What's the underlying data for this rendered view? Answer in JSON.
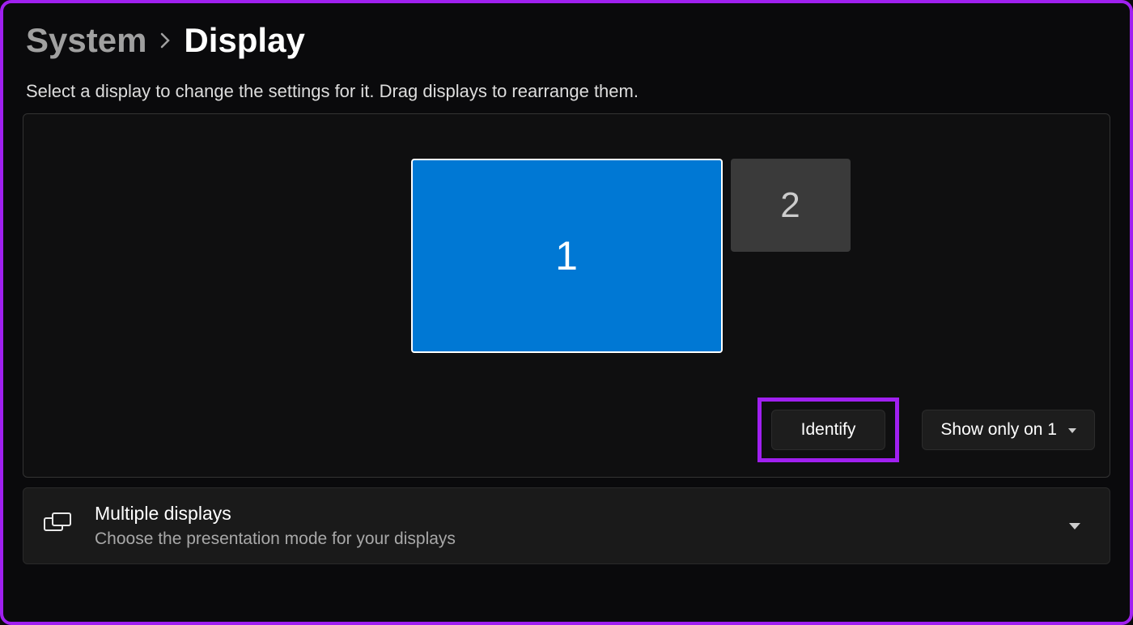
{
  "breadcrumb": {
    "parent": "System",
    "current": "Display"
  },
  "instruction": "Select a display to change the settings for it. Drag displays to rearrange them.",
  "displays": [
    {
      "label": "1",
      "selected": true
    },
    {
      "label": "2",
      "selected": false
    }
  ],
  "actions": {
    "identify_label": "Identify",
    "projection_selected": "Show only on 1"
  },
  "multiple_displays": {
    "title": "Multiple displays",
    "subtitle": "Choose the presentation mode for your displays"
  }
}
